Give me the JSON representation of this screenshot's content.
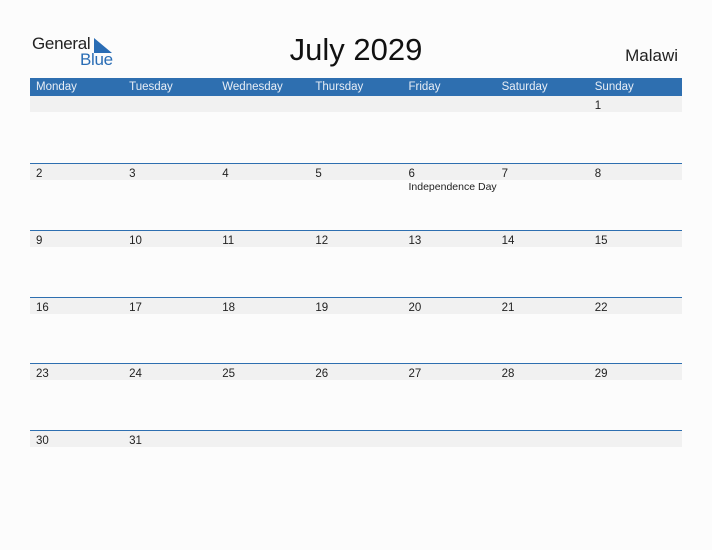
{
  "logo": {
    "general": "General",
    "blue": "Blue"
  },
  "title": "July 2029",
  "country": "Malawi",
  "weekdays": [
    "Monday",
    "Tuesday",
    "Wednesday",
    "Thursday",
    "Friday",
    "Saturday",
    "Sunday"
  ],
  "weeks": [
    {
      "days": [
        "",
        "",
        "",
        "",
        "",
        "",
        "1"
      ],
      "events": [
        "",
        "",
        "",
        "",
        "",
        "",
        ""
      ]
    },
    {
      "days": [
        "2",
        "3",
        "4",
        "5",
        "6",
        "7",
        "8"
      ],
      "events": [
        "",
        "",
        "",
        "",
        "Independence Day",
        "",
        ""
      ]
    },
    {
      "days": [
        "9",
        "10",
        "11",
        "12",
        "13",
        "14",
        "15"
      ],
      "events": [
        "",
        "",
        "",
        "",
        "",
        "",
        ""
      ]
    },
    {
      "days": [
        "16",
        "17",
        "18",
        "19",
        "20",
        "21",
        "22"
      ],
      "events": [
        "",
        "",
        "",
        "",
        "",
        "",
        ""
      ]
    },
    {
      "days": [
        "23",
        "24",
        "25",
        "26",
        "27",
        "28",
        "29"
      ],
      "events": [
        "",
        "",
        "",
        "",
        "",
        "",
        ""
      ]
    },
    {
      "days": [
        "30",
        "31",
        "",
        "",
        "",
        "",
        ""
      ],
      "events": [
        "",
        "",
        "",
        "",
        "",
        "",
        ""
      ]
    }
  ],
  "colors": {
    "accent": "#2e6fb0",
    "row_shade": "#f1f1f1"
  }
}
